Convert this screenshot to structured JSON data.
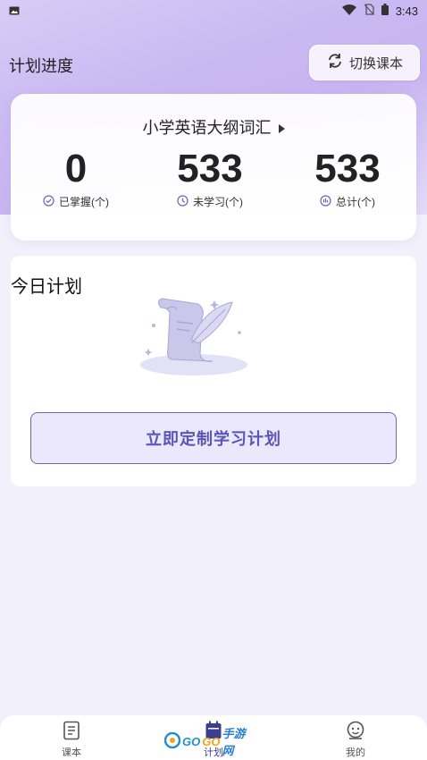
{
  "status_bar": {
    "time": "3:43"
  },
  "header": {
    "title": "计划进度",
    "switch_label": "切换课本"
  },
  "stats": {
    "book_title": "小学英语大纲词汇",
    "items": [
      {
        "value": "0",
        "label": "已掌握(个)",
        "icon": "check-circle-icon"
      },
      {
        "value": "533",
        "label": "未学习(个)",
        "icon": "clock-icon"
      },
      {
        "value": "533",
        "label": "总计(个)",
        "icon": "chart-icon"
      }
    ]
  },
  "plan": {
    "title": "今日计划",
    "button_label": "立即定制学习计划"
  },
  "nav": {
    "items": [
      {
        "label": "课本",
        "icon": "book-icon"
      },
      {
        "label": "计划",
        "icon": "calendar-icon",
        "active": true
      },
      {
        "label": "我的",
        "icon": "profile-icon"
      }
    ]
  },
  "watermark": {
    "text_a": "GO",
    "text_b": "GO",
    "text_c": "手游网"
  },
  "colors": {
    "accent": "#5a55b6",
    "nav_active": "#3b3f8f",
    "header_gradient": "#c8b4f0"
  }
}
